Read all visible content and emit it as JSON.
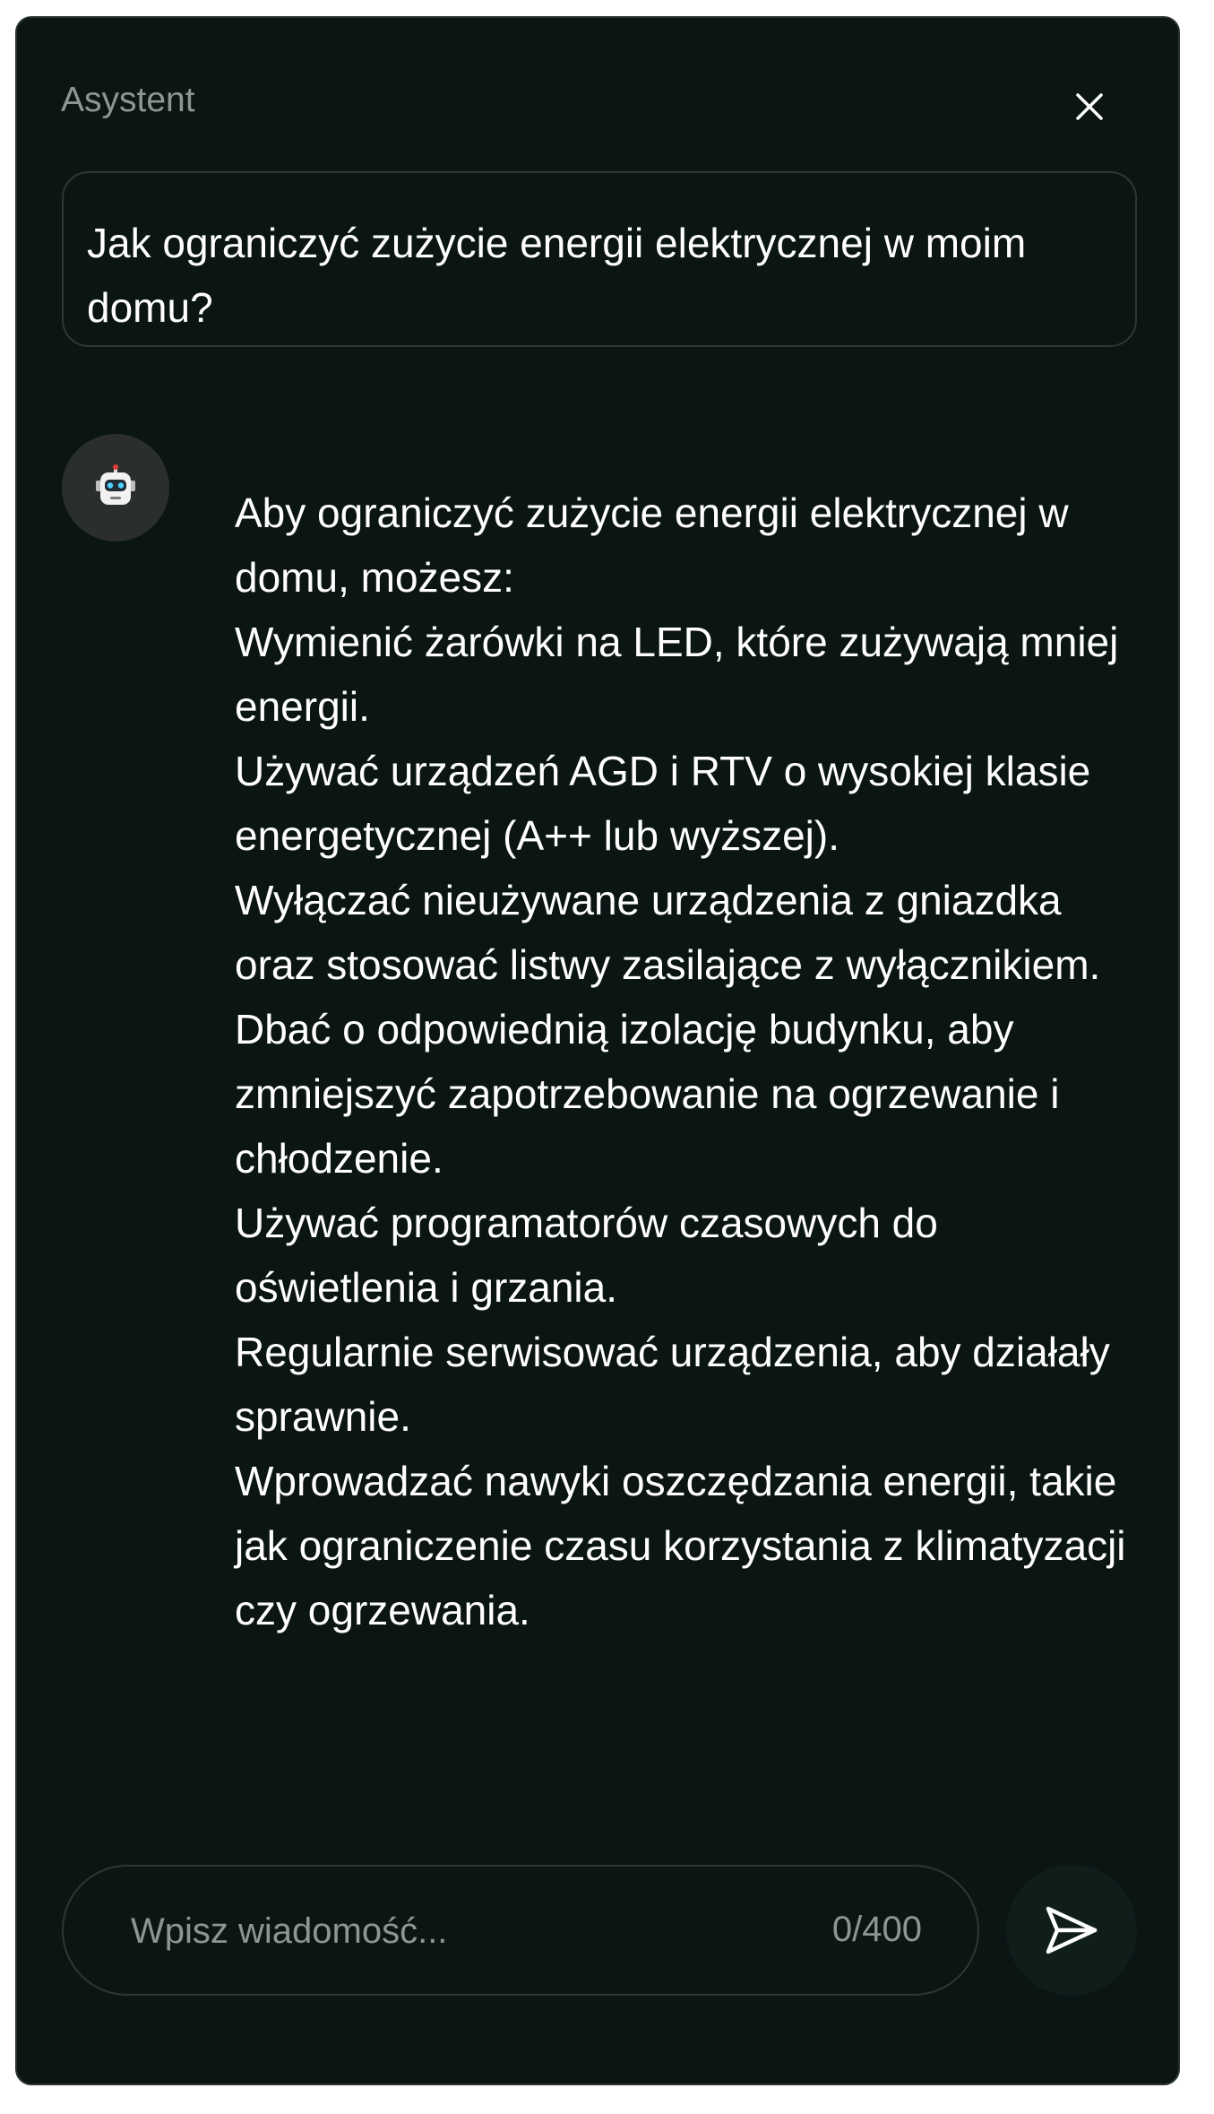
{
  "header": {
    "title": "Asystent",
    "close_icon": "close-icon"
  },
  "conversation": {
    "user_message": "Jak ograniczyć zużycie energii elektrycznej w moim domu?",
    "assistant_avatar_icon": "robot-icon",
    "assistant_lines": [
      "Aby ograniczyć zużycie energii elektrycznej w domu, możesz:",
      "Wymienić żarówki na LED, które zużywają mniej energii.",
      "Używać urządzeń AGD i RTV o wysokiej klasie energetycznej (A++ lub wyższej).",
      "Wyłączać nieużywane urządzenia z gniazdka oraz stosować listwy zasilające z wyłącznikiem.",
      "Dbać o odpowiednią izolację budynku, aby zmniejszyć zapotrzebowanie na ogrzewanie i chłodzenie.",
      "Używać programatorów czasowych do oświetlenia i grzania.",
      "Regularnie serwisować urządzenia, aby działały sprawnie.",
      "Wprowadzać nawyki oszczędzania energii, takie jak ograniczenie czasu korzystania z klimatyzacji czy ogrzewania."
    ]
  },
  "composer": {
    "placeholder": "Wpisz wiadomość...",
    "value": "",
    "counter": "0/400",
    "send_icon": "send-icon"
  },
  "colors": {
    "panel_background": "#0b1514",
    "border": "#2e3735",
    "muted_text": "#8e9694",
    "text": "#ffffff",
    "avatar_background": "#2a2f2e",
    "send_button_background": "#0f1d1b"
  }
}
